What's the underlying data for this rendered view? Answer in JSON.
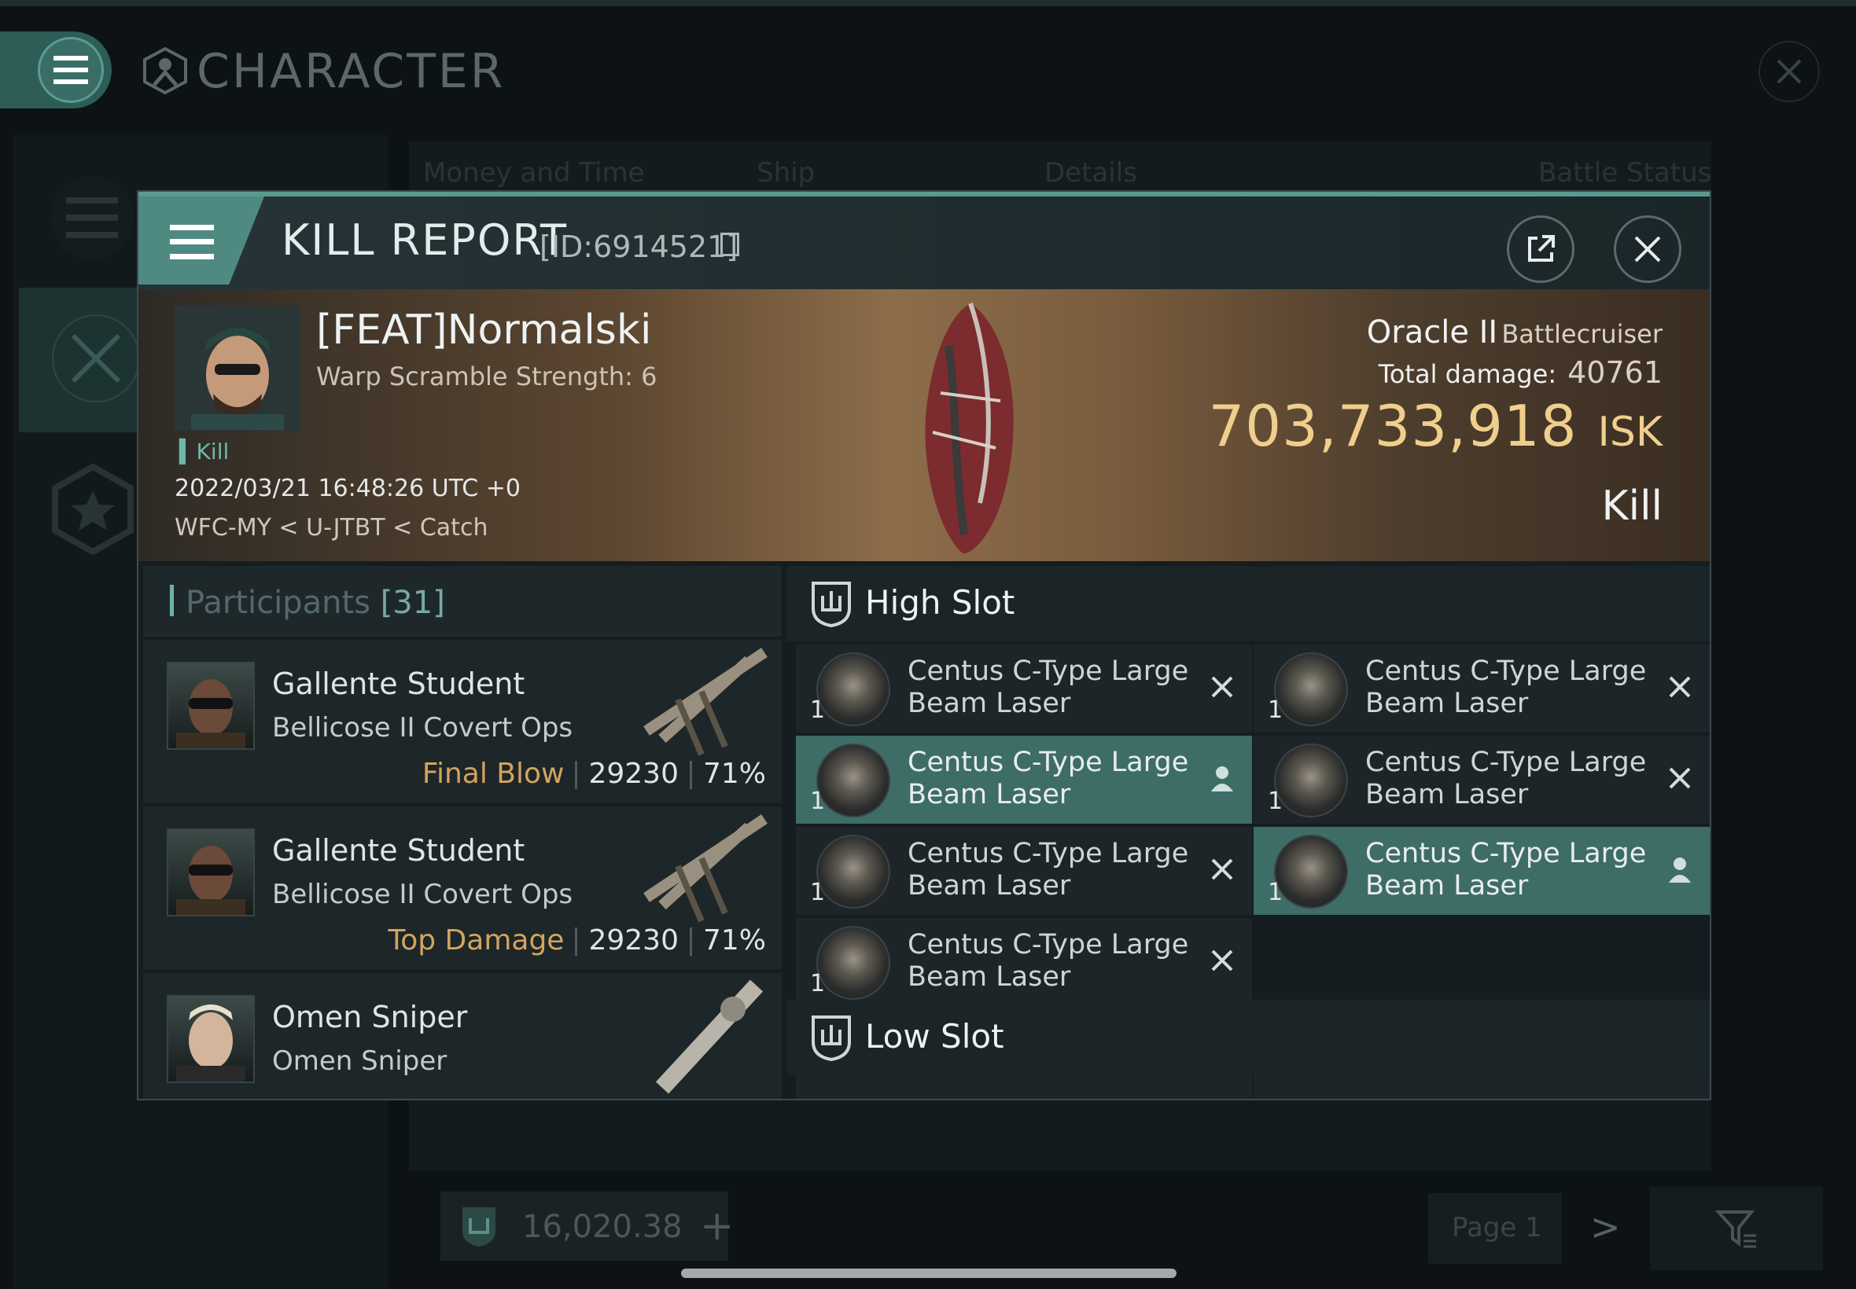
{
  "background": {
    "title": "CHARACTER",
    "columns": [
      "Money and Time",
      "Ship",
      "Details",
      "Battle Status"
    ],
    "footer": {
      "isk": "16,020.38",
      "plus": "+",
      "page": "Page 1",
      "next": ">"
    }
  },
  "modal": {
    "title": "KILL REPORT",
    "id": "[ID:6914521]",
    "banner": {
      "pilot": "[FEAT]Normalski",
      "warp": "Warp Scramble Strength: 6",
      "kill_tag": "Kill",
      "date": "2022/03/21 16:48:26 UTC +0",
      "location": "WFC-MY < U-JTBT < Catch",
      "ship": "Oracle II",
      "ship_class": "Battlecruiser",
      "total_damage_label": "Total damage:",
      "total_damage": "40761",
      "isk_value": "703,733,918",
      "isk_unit": "ISK",
      "result": "Kill"
    },
    "participants": {
      "label": "Participants",
      "count": "[31]",
      "rows": [
        {
          "name": "Gallente Student",
          "ship": "Bellicose II Covert Ops",
          "tag": "Final Blow",
          "damage": "29230",
          "percent": "71%"
        },
        {
          "name": "Gallente Student",
          "ship": "Bellicose II Covert Ops",
          "tag": "Top Damage",
          "damage": "29230",
          "percent": "71%"
        },
        {
          "name": "Omen Sniper",
          "ship": "Omen Sniper"
        }
      ]
    },
    "high_slot": {
      "title": "High Slot",
      "modules": [
        {
          "name": "Centus C-Type Large Beam Laser",
          "qty": "1",
          "state": "destroyed"
        },
        {
          "name": "Centus C-Type Large Beam Laser",
          "qty": "1",
          "state": "destroyed"
        },
        {
          "name": "Centus C-Type Large Beam Laser",
          "qty": "1",
          "state": "dropped"
        },
        {
          "name": "Centus C-Type Large Beam Laser",
          "qty": "1",
          "state": "destroyed"
        },
        {
          "name": "Centus C-Type Large Beam Laser",
          "qty": "1",
          "state": "destroyed"
        },
        {
          "name": "Centus C-Type Large Beam Laser",
          "qty": "1",
          "state": "dropped"
        },
        {
          "name": "Centus C-Type Large Beam Laser",
          "qty": "1",
          "state": "destroyed"
        }
      ]
    },
    "low_slot": {
      "title": "Low Slot"
    }
  },
  "colors": {
    "accent": "#5a9990",
    "isk": "#efcf8c",
    "tag": "#d3a45e",
    "selected": "#3d6d66"
  }
}
